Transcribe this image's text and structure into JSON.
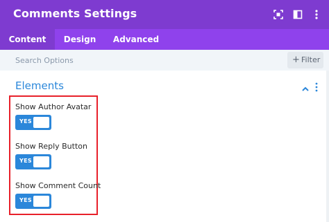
{
  "header": {
    "title": "Comments Settings",
    "bg_color": "#7e3bd0",
    "icons": [
      "focus-icon",
      "split-view-icon",
      "more-options-icon"
    ]
  },
  "tabs": [
    {
      "label": "Content",
      "active": true
    },
    {
      "label": "Design",
      "active": false
    },
    {
      "label": "Advanced",
      "active": false
    }
  ],
  "search": {
    "placeholder": "Search Options",
    "value": "",
    "filter_label": "Filter"
  },
  "section": {
    "title": "Elements",
    "expanded": true,
    "options": [
      {
        "label": "Show Author Avatar",
        "toggle": "YES"
      },
      {
        "label": "Show Reply Button",
        "toggle": "YES"
      },
      {
        "label": "Show Comment Count",
        "toggle": "YES"
      }
    ]
  },
  "colors": {
    "accent": "#2b87da",
    "tab_bar": "#8f42ec",
    "highlight": "#e8202a"
  }
}
